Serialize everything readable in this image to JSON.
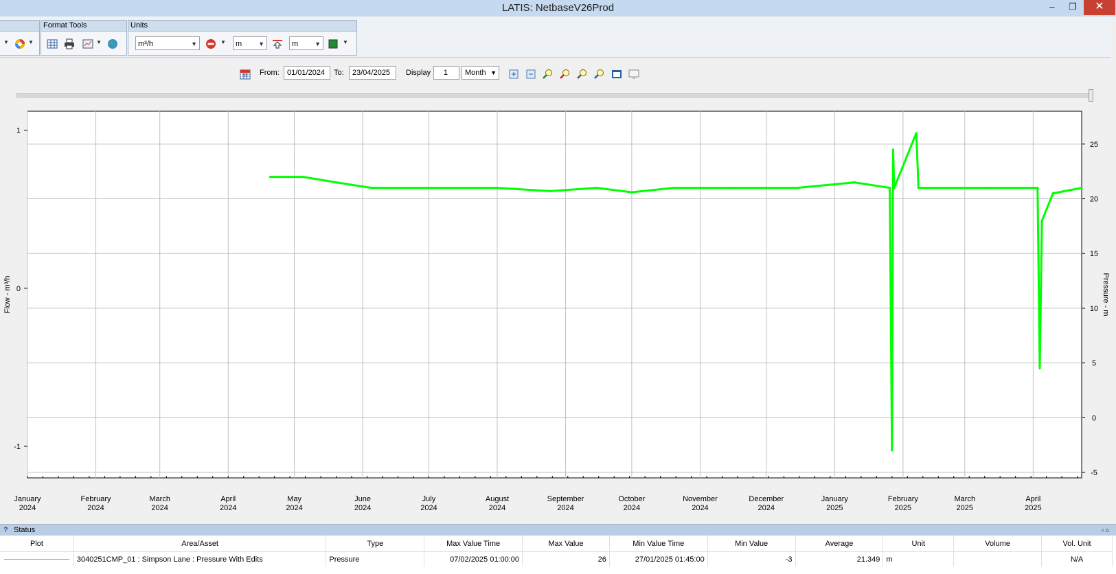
{
  "window": {
    "title": "LATIS: NetbaseV26Prod",
    "minimize": "–",
    "restore": "❐",
    "close": "✕"
  },
  "ribbon": {
    "format_tools": {
      "label": "Format Tools"
    },
    "units": {
      "label": "Units",
      "flow_unit": "m³/h",
      "pressure_unit": "m",
      "level_unit": "m"
    }
  },
  "range": {
    "from_label": "From:",
    "from_value": "01/01/2024",
    "to_label": "To:",
    "to_value": "23/04/2025",
    "display_label": "Display",
    "display_value": "1",
    "period_value": "Month"
  },
  "colors": {
    "series": "#00ff00",
    "grid": "#c0c0c0"
  },
  "chart_data": {
    "type": "line",
    "left_axis": {
      "label": "Flow - m³/h",
      "ticks": [
        "1",
        "0",
        "-1"
      ],
      "ylim": [
        -1.2,
        1.12
      ]
    },
    "right_axis": {
      "label": "Pressure - m",
      "ticks": [
        "25",
        "20",
        "15",
        "10",
        "5",
        "0",
        "-5"
      ],
      "ylim": [
        -5.5,
        28
      ]
    },
    "x_ticks": [
      {
        "month": "January",
        "year": "2024"
      },
      {
        "month": "February",
        "year": "2024"
      },
      {
        "month": "March",
        "year": "2024"
      },
      {
        "month": "April",
        "year": "2024"
      },
      {
        "month": "May",
        "year": "2024"
      },
      {
        "month": "June",
        "year": "2024"
      },
      {
        "month": "July",
        "year": "2024"
      },
      {
        "month": "August",
        "year": "2024"
      },
      {
        "month": "September",
        "year": "2024"
      },
      {
        "month": "October",
        "year": "2024"
      },
      {
        "month": "November",
        "year": "2024"
      },
      {
        "month": "December",
        "year": "2024"
      },
      {
        "month": "January",
        "year": "2025"
      },
      {
        "month": "February",
        "year": "2025"
      },
      {
        "month": "March",
        "year": "2025"
      },
      {
        "month": "April",
        "year": "2025"
      }
    ],
    "xlim": [
      "2024-01-01",
      "2025-04-23"
    ],
    "grid": true,
    "series": [
      {
        "axis": "right",
        "points": [
          [
            "2024-04-20",
            22
          ],
          [
            "2024-05-05",
            22
          ],
          [
            "2024-05-20",
            21.5
          ],
          [
            "2024-06-05",
            21
          ],
          [
            "2024-07-01",
            21
          ],
          [
            "2024-08-01",
            21
          ],
          [
            "2024-08-25",
            20.7
          ],
          [
            "2024-09-15",
            21
          ],
          [
            "2024-10-01",
            20.6
          ],
          [
            "2024-10-20",
            21
          ],
          [
            "2024-11-15",
            21
          ],
          [
            "2024-12-15",
            21
          ],
          [
            "2025-01-10",
            21.5
          ],
          [
            "2025-01-26",
            21
          ],
          [
            "2025-01-27",
            -3
          ],
          [
            "2025-01-27T12:00",
            24.5
          ],
          [
            "2025-01-28",
            21
          ],
          [
            "2025-02-07",
            26
          ],
          [
            "2025-02-08",
            21
          ],
          [
            "2025-03-10",
            21
          ],
          [
            "2025-04-03",
            21
          ],
          [
            "2025-04-04",
            4.5
          ],
          [
            "2025-04-05",
            18
          ],
          [
            "2025-04-10",
            20.5
          ],
          [
            "2025-04-23",
            21
          ]
        ]
      }
    ]
  },
  "status": {
    "title": "Status",
    "headers": [
      "Plot",
      "Area/Asset",
      "Type",
      "Max Value Time",
      "Max Value",
      "Min Value Time",
      "Min Value",
      "Average",
      "Unit",
      "Volume",
      "Vol. Unit"
    ],
    "row": {
      "asset": "3040251CMP_01 : Simpson Lane : Pressure With Edits",
      "type": "Pressure",
      "max_time": "07/02/2025 01:00:00",
      "max_value": "26",
      "min_time": "27/01/2025 01:45:00",
      "min_value": "-3",
      "average": "21.349",
      "unit": "m",
      "volume": "",
      "vol_unit": "N/A"
    }
  }
}
